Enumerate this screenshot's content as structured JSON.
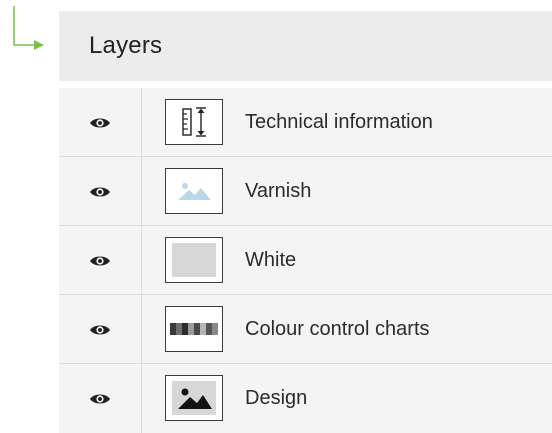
{
  "panel": {
    "title": "Layers"
  },
  "layers": [
    {
      "label": "Technical information",
      "icon": "ruler-icon",
      "visible": true
    },
    {
      "label": "Varnish",
      "icon": "image-placeholder-icon",
      "visible": true
    },
    {
      "label": "White",
      "icon": "white-swatch-icon",
      "visible": true
    },
    {
      "label": "Colour control charts",
      "icon": "color-bars-icon",
      "visible": true
    },
    {
      "label": "Design",
      "icon": "image-icon",
      "visible": true
    }
  ],
  "colors": {
    "connector": "#7cc043",
    "header_bg": "#ececec",
    "list_bg": "#f4f4f4"
  }
}
